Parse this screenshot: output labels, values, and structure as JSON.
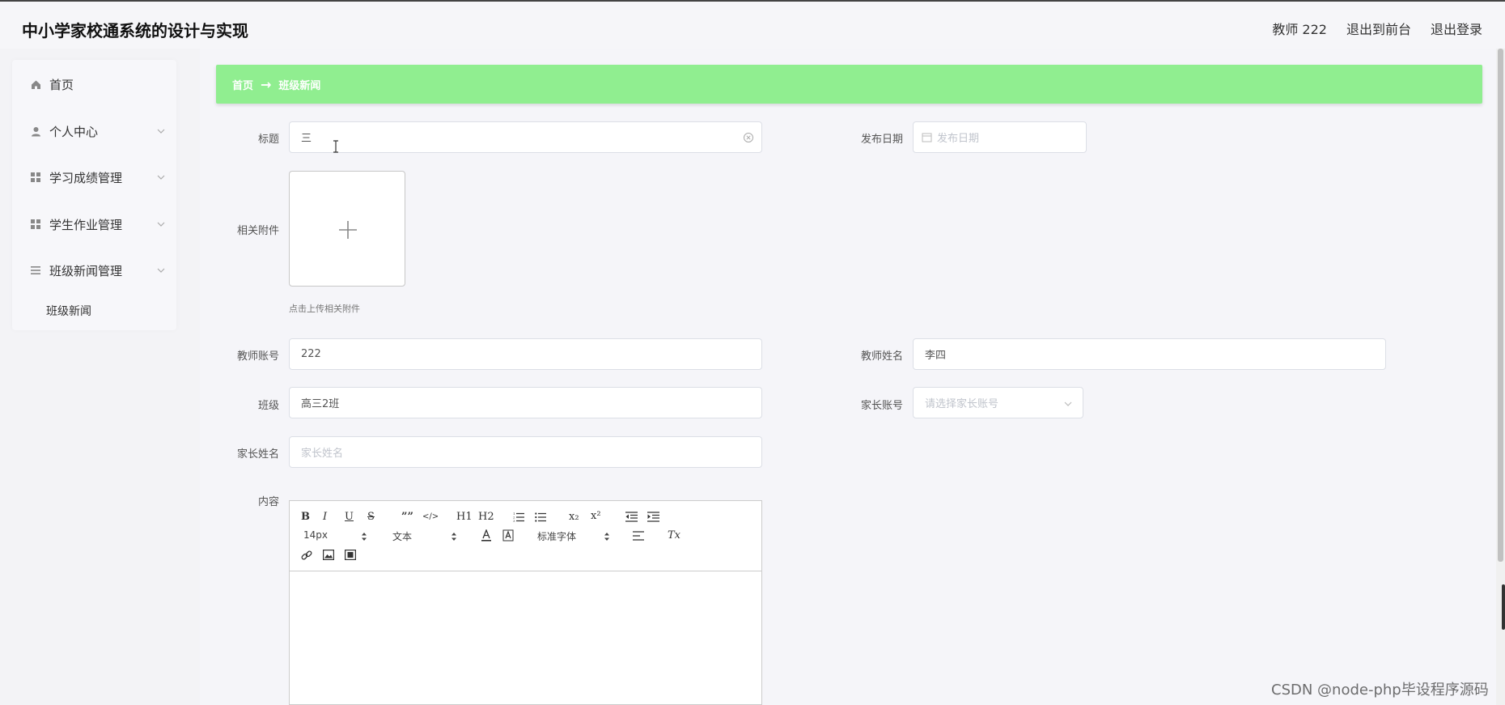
{
  "header": {
    "app_title": "中小学家校通系统的设计与实现",
    "user_label": "教师 222",
    "back_to_front": "退出到前台",
    "logout": "退出登录"
  },
  "sidebar": {
    "items": [
      {
        "label": "首页",
        "icon": "home-icon"
      },
      {
        "label": "个人中心",
        "icon": "user-icon"
      },
      {
        "label": "学习成绩管理",
        "icon": "grid-icon"
      },
      {
        "label": "学生作业管理",
        "icon": "grid-icon"
      },
      {
        "label": "班级新闻管理",
        "icon": "list-icon"
      }
    ],
    "subitem": "班级新闻"
  },
  "breadcrumb": {
    "home": "首页",
    "separator": "→",
    "current": "班级新闻"
  },
  "form": {
    "title": {
      "label": "标题",
      "value": "三"
    },
    "publish_date": {
      "label": "发布日期",
      "placeholder": "发布日期"
    },
    "attachment": {
      "label": "相关附件",
      "hint": "点击上传相关附件"
    },
    "teacher_account": {
      "label": "教师账号",
      "value": "222"
    },
    "teacher_name": {
      "label": "教师姓名",
      "value": "李四"
    },
    "class": {
      "label": "班级",
      "value": "高三2班"
    },
    "parent_account": {
      "label": "家长账号",
      "placeholder": "请选择家长账号"
    },
    "parent_name": {
      "label": "家长姓名",
      "placeholder": "家长姓名"
    },
    "content": {
      "label": "内容"
    }
  },
  "editor_toolbar": {
    "bold": "B",
    "italic": "I",
    "underline": "U",
    "strike": "S",
    "blockquote": "””",
    "code": "</>",
    "h1": "H1",
    "h2": "H2",
    "subscript": "x₂",
    "superscript": "x²",
    "font_size": "14px",
    "text_style": "文本",
    "font_family": "标准字体",
    "clear_format": "Tx"
  },
  "watermark": "CSDN @node-php毕设程序源码",
  "colors": {
    "breadcrumb_bg": "#90ee90",
    "page_bg": "#f5f5f9"
  }
}
